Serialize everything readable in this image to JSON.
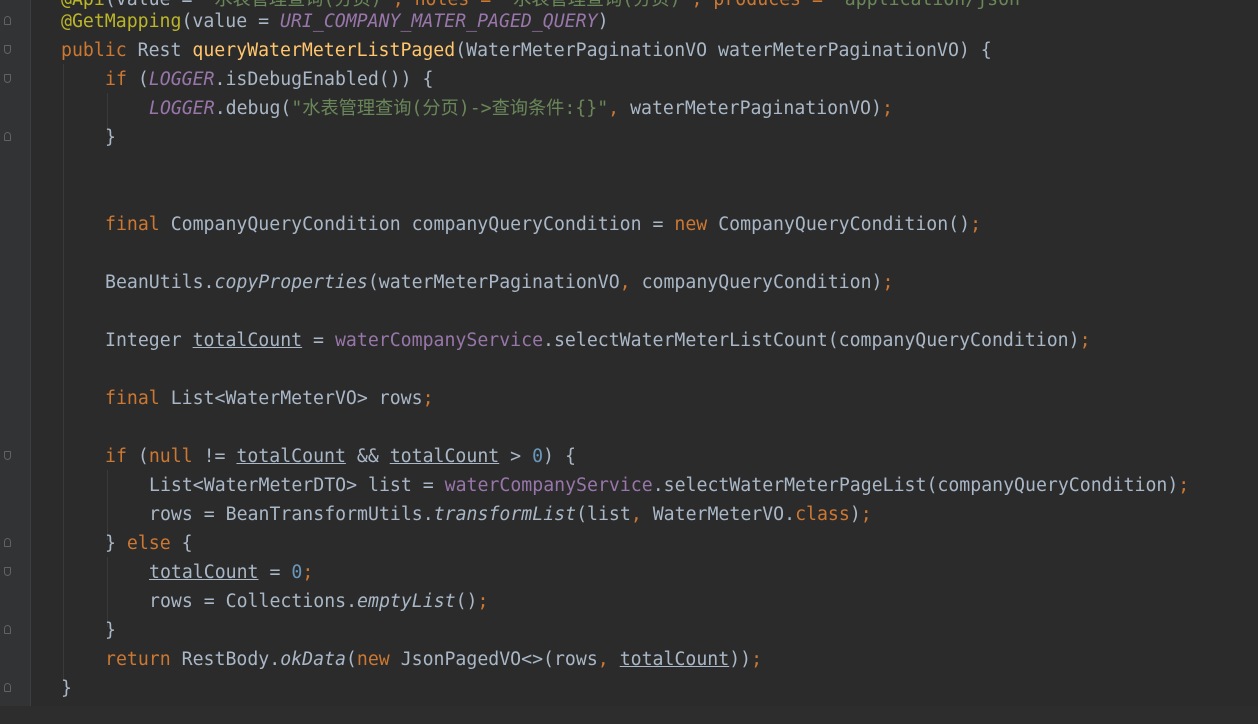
{
  "editor": {
    "line0": {
      "t1": "@Api",
      "t2": "(value = ",
      "t3": "\"水表管理查询(分页)\"",
      "t4": ", notes = ",
      "t5": "\"水表管理查询(分页)\"",
      "t6": ", produces = ",
      "t7": "\"application/json\""
    },
    "line1": {
      "t1": "@GetMapping",
      "t2": "(value = ",
      "t3": "URI_COMPANY_MATER_PAGED_QUERY",
      "t4": ")"
    },
    "line2": {
      "t1": "public ",
      "t2": "Rest ",
      "t3": "queryWaterMeterListPaged",
      "t4": "(WaterMeterPaginationVO waterMeterPaginationVO) {"
    },
    "line3": {
      "t1": "if ",
      "t2": "(",
      "t3": "LOGGER",
      "t4": ".isDebugEnabled()) {"
    },
    "line4": {
      "t1": "LOGGER",
      "t2": ".debug(",
      "t3": "\"水表管理查询(分页)->查询条件:{}\"",
      "t4": ", ",
      "t5": "waterMeterPaginationVO)",
      "t6": ";"
    },
    "line5": {
      "t1": "}"
    },
    "line8": {
      "t1": "final ",
      "t2": "CompanyQueryCondition companyQueryCondition = ",
      "t3": "new ",
      "t4": "CompanyQueryCondition()",
      "t5": ";"
    },
    "line10": {
      "t1": "BeanUtils.",
      "t2": "copyProperties",
      "t3": "(waterMeterPaginationVO",
      "t4": ", ",
      "t5": "companyQueryCondition)",
      "t6": ";"
    },
    "line12": {
      "t1": "Integer ",
      "t2": "totalCount",
      "t3": " = ",
      "t4": "waterCompanyService",
      "t5": ".selectWaterMeterListCount(companyQueryCondition)",
      "t6": ";"
    },
    "line14": {
      "t1": "final ",
      "t2": "List<WaterMeterVO> rows",
      "t3": ";"
    },
    "line16": {
      "t1": "if ",
      "t2": "(",
      "t3": "null ",
      "t4": "!= ",
      "t5": "totalCount",
      "t6": " && ",
      "t7": "totalCount",
      "t8": " > ",
      "t9": "0",
      "t10": ") {"
    },
    "line17": {
      "t1": "List<WaterMeterDTO> list = ",
      "t2": "waterCompanyService",
      "t3": ".selectWaterMeterPageList(companyQueryCondition)",
      "t4": ";"
    },
    "line18": {
      "t1": "rows = BeanTransformUtils.",
      "t2": "transformList",
      "t3": "(list",
      "t4": ", ",
      "t5": "WaterMeterVO.",
      "t6": "class",
      "t7": ")",
      "t8": ";"
    },
    "line19": {
      "t1": "} ",
      "t2": "else ",
      "t3": "{"
    },
    "line20": {
      "t1": "totalCount",
      "t2": " = ",
      "t3": "0",
      "t4": ";"
    },
    "line21": {
      "t1": "rows = Collections.",
      "t2": "emptyList",
      "t3": "()",
      "t4": ";"
    },
    "line22": {
      "t1": "}"
    },
    "line23": {
      "t1": "return ",
      "t2": "RestBody.",
      "t3": "okData",
      "t4": "(",
      "t5": "new ",
      "t6": "JsonPagedVO<>(rows",
      "t7": ", ",
      "t8": "totalCount",
      "t9": "))",
      "t10": ";"
    },
    "line24": {
      "t1": "}"
    }
  }
}
